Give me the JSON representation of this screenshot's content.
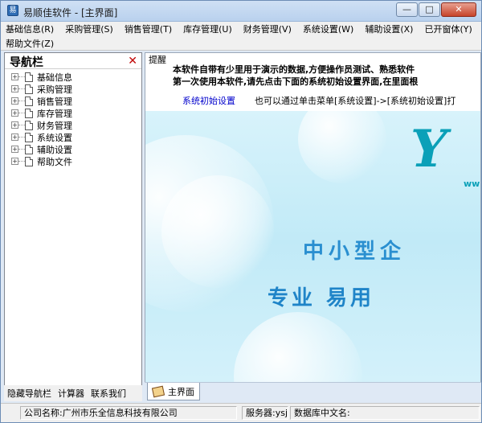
{
  "window": {
    "title": "易顺佳软件 - [主界面]",
    "buttons": {
      "minimize": "—",
      "maximize": "□",
      "close": "✕"
    }
  },
  "menu": {
    "row1": [
      "基础信息(R)",
      "采购管理(S)",
      "销售管理(T)",
      "库存管理(U)",
      "财务管理(V)",
      "系统设置(W)",
      "辅助设置(X)",
      "已开窗体(Y)"
    ],
    "row2": [
      "帮助文件(Z)"
    ]
  },
  "nav": {
    "title": "导航栏",
    "close": "✕",
    "items": [
      "基础信息",
      "采购管理",
      "销售管理",
      "库存管理",
      "财务管理",
      "系统设置",
      "辅助设置",
      "帮助文件"
    ],
    "expander": "+",
    "footer": [
      "隐藏导航栏",
      "计算器",
      "联系我们"
    ]
  },
  "notice": {
    "label": "提醒",
    "line1": "本软件自带有少里用于演示的数据,方便操作员测试、熟悉软件",
    "line2": "第一次使用本软件,请先点击下面的系统初始设置界面,在里面根",
    "link": "系统初始设置",
    "hint": "也可以通过单击菜单[系统设置]->[系统初始设置]打"
  },
  "banner": {
    "logo": "Y",
    "logo_sub": "ww",
    "slogan1": "中小型企",
    "slogan2": "专业 易用"
  },
  "tabs": [
    {
      "label": "主界面"
    }
  ],
  "status": {
    "company": "公司名称:广州市乐全信息科技有限公司",
    "server": "服务器:ysj",
    "db": "数据库中文名:"
  },
  "colors": {
    "title_bar": "#cfe0f4",
    "link": "#0000cc",
    "nav_close": "#c00000",
    "banner_bg": "#c1eaf7",
    "slogan": "#2a8fd0"
  }
}
